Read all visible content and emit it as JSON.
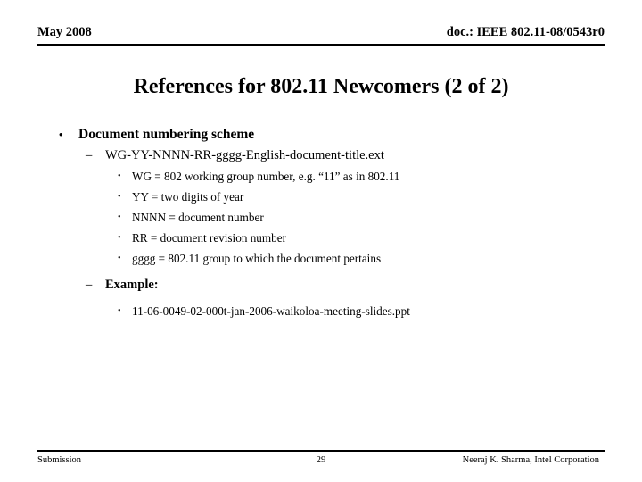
{
  "header": {
    "left": "May 2008",
    "right": "doc.: IEEE 802.11-08/0543r0"
  },
  "title": "References for 802.11 Newcomers (2 of 2)",
  "bullets": {
    "l1_document_numbering_scheme": "Document numbering scheme",
    "l2_scheme_pattern": "WG-YY-NNNN-RR-gggg-English-document-title.ext",
    "l3_wg": "WG = 802 working group number, e.g. “11” as in 802.11",
    "l3_yy": "YY = two digits of year",
    "l3_nnnn": "NNNN = document number",
    "l3_rr": "RR = document revision number",
    "l3_gggg": "gggg = 802.11 group to which the document pertains",
    "l2_example_label": "Example:",
    "l3_example_value": "11-06-0049-02-000t-jan-2006-waikoloa-meeting-slides.ppt"
  },
  "markers": {
    "bullet_round": "•",
    "dash": "–"
  },
  "footer": {
    "left": "Submission",
    "page_number": "29",
    "right": "Neeraj K. Sharma, Intel Corporation"
  },
  "colors": {
    "text": "#000000",
    "background": "#ffffff",
    "rule": "#000000"
  }
}
